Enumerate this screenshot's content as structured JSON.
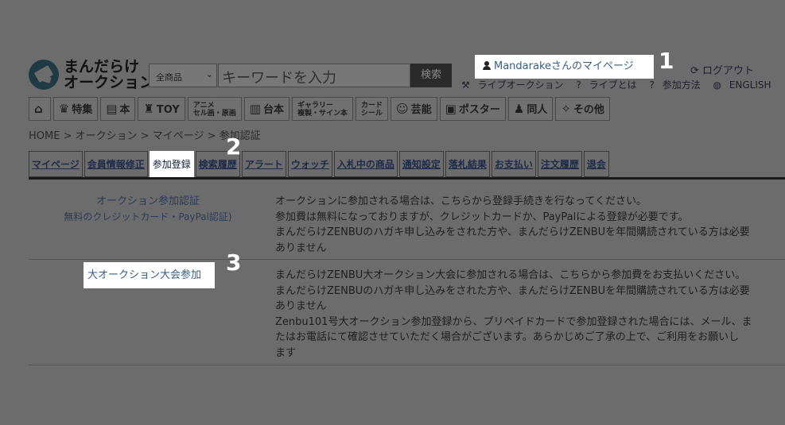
{
  "logo": {
    "line1": "まんだらけ",
    "line2": "オークション",
    "icon": "mandarake-logo-icon"
  },
  "search": {
    "category": "全商品",
    "placeholder": "キーワードを入力",
    "button": "検索"
  },
  "account": {
    "mypage_link": "Mandarakeさんのマイページ",
    "logout": "ログアウト"
  },
  "sub_links": {
    "live_auction": "ライブオークション",
    "what_is_live": "ライブとは",
    "how_to_join": "参加方法",
    "english": "ENGLISH"
  },
  "categories": [
    {
      "icon": "home-icon",
      "label": ""
    },
    {
      "icon": "crown-icon",
      "label": "特集"
    },
    {
      "icon": "book-icon",
      "label": "本"
    },
    {
      "icon": "robot-icon",
      "label": "TOY"
    },
    {
      "icon": "anime-icon",
      "label": "アニメ",
      "sub": "セル画・原画"
    },
    {
      "icon": "open-book-icon",
      "label": "台本"
    },
    {
      "icon": "gallery-icon",
      "label": "ギャラリー",
      "sub": "複製・サイン本"
    },
    {
      "icon": "card-icon",
      "label": "カード",
      "sub": "シール"
    },
    {
      "icon": "mask-icon",
      "label": "芸能"
    },
    {
      "icon": "poster-icon",
      "label": "ポスター"
    },
    {
      "icon": "people-icon",
      "label": "同人"
    },
    {
      "icon": "other-icon",
      "label": "その他"
    }
  ],
  "breadcrumb": "HOME > オークション > マイページ > 参加認証",
  "tabs": [
    "マイページ",
    "会員情報修正",
    "参加登録",
    "検索履歴",
    "アラート",
    "ウォッチ",
    "入札中の商品",
    "通知設定",
    "落札結果",
    "お支払い",
    "注文履歴",
    "退会"
  ],
  "rows": [
    {
      "label_line1": "オークション参加認証",
      "label_line2": "無料のクレジットカード・PayPal認証)",
      "desc": [
        "オークションに参加される場合は、こちらから登録手続きを行なってください。",
        "参加費は無料になっておりますが、クレジットカードか、PayPalによる登録が必要です。",
        "まんだらけZENBUのハガキ申し込みをされた方や、まんだらけZENBUを年間購読されている方は必要",
        "ありません"
      ]
    },
    {
      "label_line1": "大オークション大会参加",
      "desc": [
        "まんだらけZENBU大オークション大会に参加される場合は、こちらから参加費をお支払いください。",
        "まんだらけZENBUのハガキ申し込みをされた方や、まんだらけZENBUを年間購読されている方は必要",
        "ありません",
        "Zenbu101号大オークション参加登録から、プリペイドカードで参加登録された場合には、メール、ま",
        "たはお電話にて確認させていただく場合がございます。あらかじめご了承の上で、ご利用をお願いし",
        "ます"
      ]
    }
  ],
  "callouts": [
    "1",
    "2",
    "3"
  ]
}
